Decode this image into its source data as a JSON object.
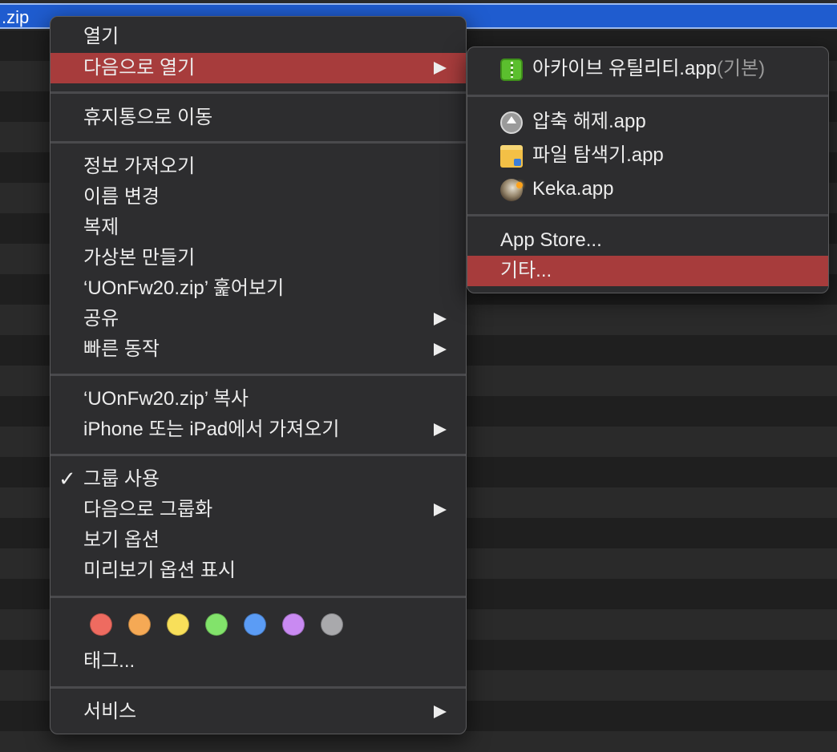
{
  "selected_file": ".zip",
  "main_menu": {
    "items": [
      {
        "label": "열기"
      },
      {
        "label": "다음으로 열기"
      },
      {
        "label": "휴지통으로 이동"
      },
      {
        "label": "정보 가져오기"
      },
      {
        "label": "이름 변경"
      },
      {
        "label": "복제"
      },
      {
        "label": "가상본 만들기"
      },
      {
        "label": "‘UOnFw20.zip’ 훑어보기"
      },
      {
        "label": "공유"
      },
      {
        "label": "빠른 동작"
      },
      {
        "label": "‘UOnFw20.zip’ 복사"
      },
      {
        "label": "iPhone 또는 iPad에서 가져오기"
      },
      {
        "label": "그룹 사용"
      },
      {
        "label": "다음으로 그룹화"
      },
      {
        "label": "보기 옵션"
      },
      {
        "label": "미리보기 옵션 표시"
      },
      {
        "label": "태그..."
      },
      {
        "label": "서비스"
      }
    ],
    "check_mark": "✓",
    "tag_colors": [
      {
        "name": "red",
        "color": "#ee6b60"
      },
      {
        "name": "orange",
        "color": "#f5a955"
      },
      {
        "name": "yellow",
        "color": "#f8df5a"
      },
      {
        "name": "green",
        "color": "#82e36b"
      },
      {
        "name": "blue",
        "color": "#5b9cf5"
      },
      {
        "name": "purple",
        "color": "#c98af2"
      },
      {
        "name": "gray",
        "color": "#a9a9ac"
      }
    ]
  },
  "submenu": {
    "items": [
      {
        "label": "아카이브 유틸리티.app",
        "suffix": "(기본)",
        "icon": "archive-utility-icon"
      },
      {
        "label": "압축 해제.app",
        "icon": "unzip-app-icon"
      },
      {
        "label": "파일 탐색기.app",
        "icon": "file-explorer-icon"
      },
      {
        "label": "Keka.app",
        "icon": "keka-icon"
      },
      {
        "label": "App Store..."
      },
      {
        "label": "기타..."
      }
    ]
  },
  "colors": {
    "highlight": "#a73c3c",
    "menu_bg": "#2d2d2f",
    "selection_blue": "#1f5ccf"
  }
}
